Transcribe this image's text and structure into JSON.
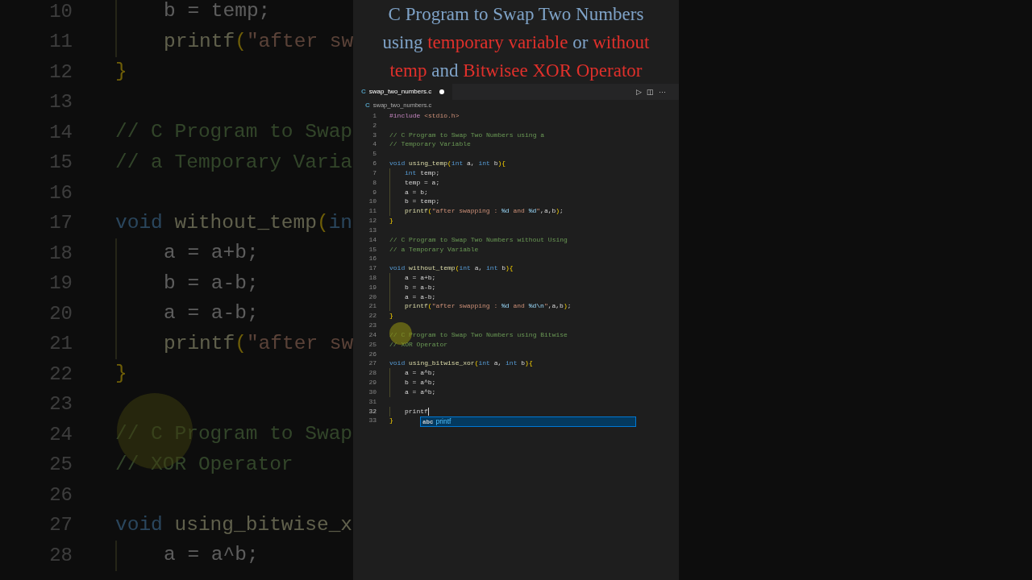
{
  "title": {
    "lines": [
      [
        {
          "kind": "plain",
          "text": "C Program to Swap Two Numbers"
        }
      ],
      [
        {
          "kind": "plain",
          "text": "using "
        },
        {
          "kind": "accent",
          "text": "temporary variable"
        },
        {
          "kind": "plain",
          "text": " or "
        },
        {
          "kind": "accent",
          "text": "without"
        }
      ],
      [
        {
          "kind": "accent",
          "text": "temp"
        },
        {
          "kind": "plain",
          "text": " and "
        },
        {
          "kind": "accent",
          "text": "Bitwisee XOR Operator"
        }
      ]
    ]
  },
  "tab": {
    "icon": "C",
    "label": "swap_two_numbers.c",
    "modified": true,
    "actions": [
      "▷",
      "◫",
      "···"
    ]
  },
  "breadcrumb": {
    "icon": "C",
    "label": "swap_two_numbers.c"
  },
  "background_code": [
    {
      "n": "10",
      "indented": true,
      "code": [
        {
          "kind": "tx",
          "text": "b = temp;"
        }
      ]
    },
    {
      "n": "11",
      "indented": true,
      "code": [
        {
          "kind": "fn",
          "text": "printf"
        },
        {
          "kind": "br",
          "text": "("
        },
        {
          "kind": "str",
          "text": "\"after sw"
        }
      ]
    },
    {
      "n": "12",
      "indented": false,
      "code": [
        {
          "kind": "br",
          "text": "}"
        }
      ]
    },
    {
      "n": "13",
      "indented": false
    },
    {
      "n": "14",
      "indented": false,
      "code": [
        {
          "kind": "cm",
          "text": "// C Program to Swap"
        }
      ]
    },
    {
      "n": "15",
      "indented": false,
      "code": [
        {
          "kind": "cm",
          "text": "// a Temporary Varia"
        }
      ]
    },
    {
      "n": "16",
      "indented": false
    },
    {
      "n": "17",
      "indented": false,
      "code": [
        {
          "kind": "kw",
          "text": "void "
        },
        {
          "kind": "fn",
          "text": "without_temp"
        },
        {
          "kind": "br",
          "text": "("
        },
        {
          "kind": "kw",
          "text": "in"
        }
      ]
    },
    {
      "n": "18",
      "indented": true,
      "code": [
        {
          "kind": "tx",
          "text": "a = a+b;"
        }
      ]
    },
    {
      "n": "19",
      "indented": true,
      "code": [
        {
          "kind": "tx",
          "text": "b = a-b;"
        }
      ]
    },
    {
      "n": "20",
      "indented": true,
      "code": [
        {
          "kind": "tx",
          "text": "a = a-b;"
        }
      ]
    },
    {
      "n": "21",
      "indented": true,
      "code": [
        {
          "kind": "fn",
          "text": "printf"
        },
        {
          "kind": "br",
          "text": "("
        },
        {
          "kind": "str",
          "text": "\"after sw"
        }
      ]
    },
    {
      "n": "22",
      "indented": false,
      "code": [
        {
          "kind": "br",
          "text": "}"
        }
      ]
    },
    {
      "n": "23",
      "indented": false
    },
    {
      "n": "24",
      "indented": false,
      "code": [
        {
          "kind": "cm",
          "text": "// C Program to Swap"
        }
      ]
    },
    {
      "n": "25",
      "indented": false,
      "code": [
        {
          "kind": "cm",
          "text": "// XOR Operator"
        }
      ]
    },
    {
      "n": "26",
      "indented": false
    },
    {
      "n": "27",
      "indented": false,
      "code": [
        {
          "kind": "kw",
          "text": "void "
        },
        {
          "kind": "fn",
          "text": "using_bitwise_x"
        }
      ]
    },
    {
      "n": "28",
      "indented": true,
      "code": [
        {
          "kind": "tx",
          "text": "a = a^b;"
        }
      ]
    }
  ],
  "code": [
    {
      "n": "1",
      "current": false,
      "indented": false,
      "code": [
        {
          "kind": "pp",
          "text": "#include "
        },
        {
          "kind": "str",
          "text": "<stdio.h>"
        }
      ]
    },
    {
      "n": "2",
      "current": false,
      "indented": false
    },
    {
      "n": "3",
      "current": false,
      "indented": false,
      "code": [
        {
          "kind": "cm",
          "text": "// C Program to Swap Two Numbers using a"
        }
      ]
    },
    {
      "n": "4",
      "current": false,
      "indented": false,
      "code": [
        {
          "kind": "cm",
          "text": "// Temporary Variable"
        }
      ]
    },
    {
      "n": "5",
      "current": false,
      "indented": false
    },
    {
      "n": "6",
      "current": false,
      "indented": false,
      "code": [
        {
          "kind": "kw",
          "text": "void "
        },
        {
          "kind": "fn",
          "text": "using_temp"
        },
        {
          "kind": "br",
          "text": "("
        },
        {
          "kind": "kw",
          "text": "int"
        },
        {
          "kind": "tx",
          "text": " a, "
        },
        {
          "kind": "kw",
          "text": "int"
        },
        {
          "kind": "tx",
          "text": " b"
        },
        {
          "kind": "br",
          "text": "){"
        }
      ]
    },
    {
      "n": "7",
      "current": false,
      "indented": true,
      "code": [
        {
          "kind": "kw",
          "text": "int"
        },
        {
          "kind": "tx",
          "text": " temp;"
        }
      ]
    },
    {
      "n": "8",
      "current": false,
      "indented": true,
      "code": [
        {
          "kind": "tx",
          "text": "temp = a;"
        }
      ]
    },
    {
      "n": "9",
      "current": false,
      "indented": true,
      "code": [
        {
          "kind": "tx",
          "text": "a = b;"
        }
      ]
    },
    {
      "n": "10",
      "current": false,
      "indented": true,
      "code": [
        {
          "kind": "tx",
          "text": "b = temp;"
        }
      ]
    },
    {
      "n": "11",
      "current": false,
      "indented": true,
      "code": [
        {
          "kind": "fn",
          "text": "printf"
        },
        {
          "kind": "br",
          "text": "("
        },
        {
          "kind": "str",
          "text": "\"after swapping : "
        },
        {
          "kind": "fmt",
          "text": "%d"
        },
        {
          "kind": "str",
          "text": " and "
        },
        {
          "kind": "fmt",
          "text": "%d"
        },
        {
          "kind": "str",
          "text": "\""
        },
        {
          "kind": "tx",
          "text": ",a,b"
        },
        {
          "kind": "br",
          "text": ")"
        },
        {
          "kind": "tx",
          "text": ";"
        }
      ]
    },
    {
      "n": "12",
      "current": false,
      "indented": false,
      "code": [
        {
          "kind": "br",
          "text": "}"
        }
      ]
    },
    {
      "n": "13",
      "current": false,
      "indented": false
    },
    {
      "n": "14",
      "current": false,
      "indented": false,
      "code": [
        {
          "kind": "cm",
          "text": "// C Program to Swap Two Numbers without Using"
        }
      ]
    },
    {
      "n": "15",
      "current": false,
      "indented": false,
      "code": [
        {
          "kind": "cm",
          "text": "// a Temporary Variable"
        }
      ]
    },
    {
      "n": "16",
      "current": false,
      "indented": false
    },
    {
      "n": "17",
      "current": false,
      "indented": false,
      "code": [
        {
          "kind": "kw",
          "text": "void "
        },
        {
          "kind": "fn",
          "text": "without_temp"
        },
        {
          "kind": "br",
          "text": "("
        },
        {
          "kind": "kw",
          "text": "int"
        },
        {
          "kind": "tx",
          "text": " a, "
        },
        {
          "kind": "kw",
          "text": "int"
        },
        {
          "kind": "tx",
          "text": " b"
        },
        {
          "kind": "br",
          "text": "){"
        }
      ]
    },
    {
      "n": "18",
      "current": false,
      "indented": true,
      "code": [
        {
          "kind": "tx",
          "text": "a = a+b;"
        }
      ]
    },
    {
      "n": "19",
      "current": false,
      "indented": true,
      "code": [
        {
          "kind": "tx",
          "text": "b = a-b;"
        }
      ]
    },
    {
      "n": "20",
      "current": false,
      "indented": true,
      "code": [
        {
          "kind": "tx",
          "text": "a = a-b;"
        }
      ]
    },
    {
      "n": "21",
      "current": false,
      "indented": true,
      "code": [
        {
          "kind": "fn",
          "text": "printf"
        },
        {
          "kind": "br",
          "text": "("
        },
        {
          "kind": "str",
          "text": "\"after swapping : "
        },
        {
          "kind": "fmt",
          "text": "%d"
        },
        {
          "kind": "str",
          "text": " and "
        },
        {
          "kind": "fmt",
          "text": "%d\\n"
        },
        {
          "kind": "str",
          "text": "\""
        },
        {
          "kind": "tx",
          "text": ",a,b"
        },
        {
          "kind": "br",
          "text": ")"
        },
        {
          "kind": "tx",
          "text": ";"
        }
      ]
    },
    {
      "n": "22",
      "current": false,
      "indented": false,
      "code": [
        {
          "kind": "br",
          "text": "}"
        }
      ]
    },
    {
      "n": "23",
      "current": false,
      "indented": false
    },
    {
      "n": "24",
      "current": false,
      "indented": false,
      "code": [
        {
          "kind": "cm",
          "text": "// C Program to Swap Two Numbers using Bitwise"
        }
      ]
    },
    {
      "n": "25",
      "current": false,
      "indented": false,
      "code": [
        {
          "kind": "cm",
          "text": "// XOR Operator"
        }
      ]
    },
    {
      "n": "26",
      "current": false,
      "indented": false
    },
    {
      "n": "27",
      "current": false,
      "indented": false,
      "code": [
        {
          "kind": "kw",
          "text": "void "
        },
        {
          "kind": "fn",
          "text": "using_bitwise_xor"
        },
        {
          "kind": "br",
          "text": "("
        },
        {
          "kind": "kw",
          "text": "int"
        },
        {
          "kind": "tx",
          "text": " a, "
        },
        {
          "kind": "kw",
          "text": "int"
        },
        {
          "kind": "tx",
          "text": " b"
        },
        {
          "kind": "br",
          "text": "){"
        }
      ]
    },
    {
      "n": "28",
      "current": false,
      "indented": true,
      "code": [
        {
          "kind": "tx",
          "text": "a = a^b;"
        }
      ]
    },
    {
      "n": "29",
      "current": false,
      "indented": true,
      "code": [
        {
          "kind": "tx",
          "text": "b = a^b;"
        }
      ]
    },
    {
      "n": "30",
      "current": false,
      "indented": true,
      "code": [
        {
          "kind": "tx",
          "text": "a = a^b;"
        }
      ]
    },
    {
      "n": "31",
      "current": false,
      "indented": false
    },
    {
      "n": "32",
      "current": true,
      "indented": true,
      "code": [
        {
          "kind": "tx",
          "text": "printf"
        }
      ]
    },
    {
      "n": "33",
      "current": false,
      "indented": false,
      "code": [
        {
          "kind": "br",
          "text": "}"
        }
      ]
    }
  ],
  "suggestion": {
    "icon": "abc",
    "label": "printf",
    "selected": true
  }
}
